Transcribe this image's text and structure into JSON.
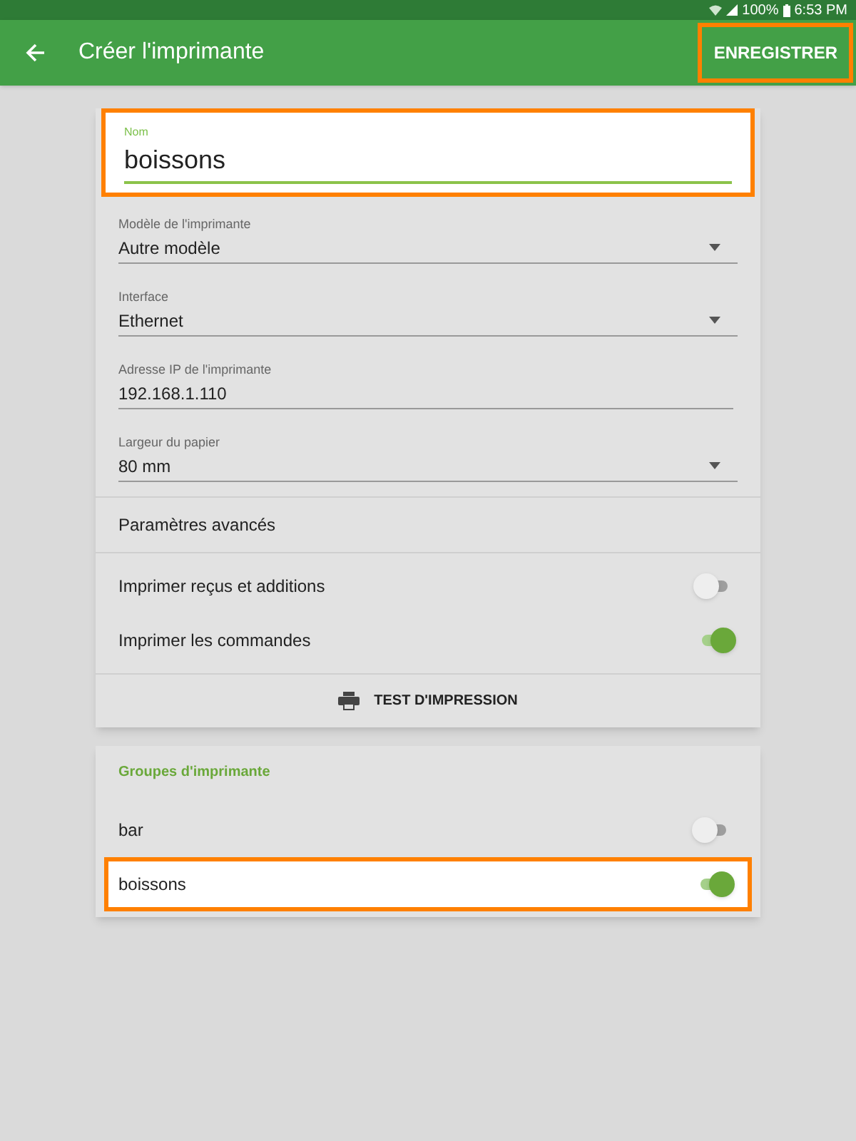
{
  "status_bar": {
    "battery": "100%",
    "time": "6:53 PM"
  },
  "app_bar": {
    "title": "Créer l'imprimante",
    "action": {
      "label": "ENREGISTRER",
      "highlighted": true
    }
  },
  "name_field": {
    "label": "Nom",
    "value": "boissons",
    "highlighted": true
  },
  "fields": [
    {
      "kind": "select",
      "label": "Modèle de l'imprimante",
      "value": "Autre modèle"
    },
    {
      "kind": "select",
      "label": "Interface",
      "value": "Ethernet"
    },
    {
      "kind": "text",
      "label": "Adresse IP de l'imprimante",
      "value": "192.168.1.110"
    },
    {
      "kind": "select",
      "label": "Largeur du papier",
      "value": "80 mm"
    }
  ],
  "advanced": "Paramètres avancés",
  "options": [
    {
      "label": "Imprimer reçus et additions",
      "on": false
    },
    {
      "label": "Imprimer les commandes",
      "on": true
    }
  ],
  "test_button": "TEST D'IMPRESSION",
  "groups": {
    "title": "Groupes d'imprimante",
    "items": [
      {
        "label": "bar",
        "on": false,
        "highlighted": false
      },
      {
        "label": "boissons",
        "on": true,
        "highlighted": true
      }
    ]
  }
}
